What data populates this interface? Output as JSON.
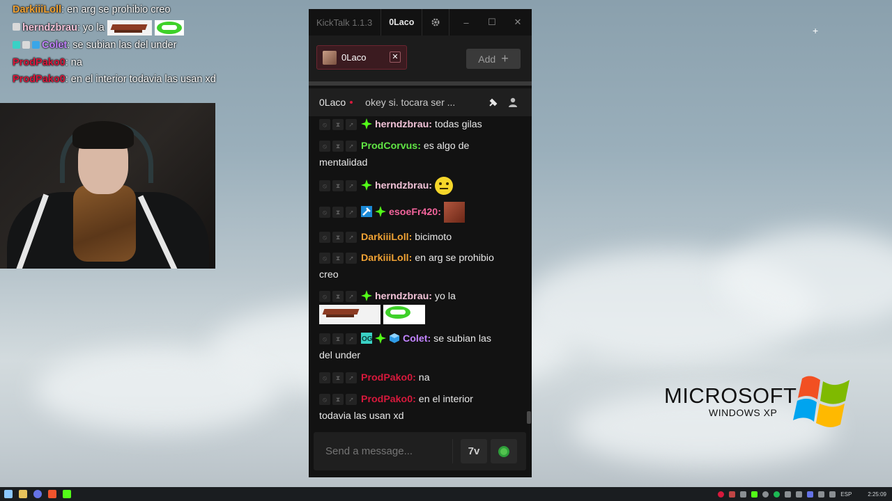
{
  "overlay_chat": [
    {
      "user": "DarkiiiLoll",
      "color": "orange",
      "text": ": en arg se prohibio creo",
      "emotes": []
    },
    {
      "user": "herndzbrau",
      "color": "pink",
      "text": ": yo la",
      "emotes": [
        "bench",
        "grin"
      ],
      "badges": [
        "brain"
      ]
    },
    {
      "user": "Colet",
      "color": "purple",
      "text": ": se subian las del under",
      "badges": [
        "og",
        "brain",
        "cube"
      ]
    },
    {
      "user": "ProdPako0",
      "color": "red",
      "text": ": na"
    },
    {
      "user": "ProdPako0",
      "color": "red",
      "text": ": en el interior todavia las usan xd"
    }
  ],
  "kicktalk": {
    "app_title": "KickTalk 1.1.3",
    "username": "0Laco",
    "tab": {
      "name": "0Laco"
    },
    "add_label": "Add",
    "chat_header": {
      "channel": "0Laco",
      "stream_title": "okey si. tocara ser ..."
    },
    "messages": [
      {
        "user": "herndzbrau",
        "color": "pink",
        "text": " todas gilas"
      },
      {
        "user": "ProdCorvus",
        "color": "green",
        "text": " es algo de",
        "text2": "mentalidad"
      },
      {
        "user": "herndzbrau",
        "color": "pink",
        "text": ""
      },
      {
        "user": "esoeFr420",
        "color": "salmon",
        "text": ""
      },
      {
        "user": "DarkiiiLoll",
        "color": "orange",
        "text": " bicimoto"
      },
      {
        "user": "DarkiiiLoll",
        "color": "orange",
        "text": " en arg se prohibio",
        "text2": "creo"
      },
      {
        "user": "herndzbrau",
        "color": "pink",
        "text": " yo la"
      },
      {
        "user": "Colet",
        "color": "purple",
        "text": " se subian las",
        "text2": "del under"
      },
      {
        "user": "ProdPako0",
        "color": "red",
        "text": " na"
      },
      {
        "user": "ProdPako0",
        "color": "red",
        "text": " en el interior",
        "text2": "todavia las usan xd"
      }
    ],
    "input_placeholder": "Send a message...",
    "emote_button_label": "7v"
  },
  "desktop": {
    "brand_line1": "MICROSOFT",
    "brand_line2": "WINDOWS XP"
  },
  "taskbar": {
    "lang": "ESP",
    "time": "2:25:09"
  },
  "colors": {
    "kick_green": "#53fc18",
    "accent_red": "#d7193c"
  }
}
